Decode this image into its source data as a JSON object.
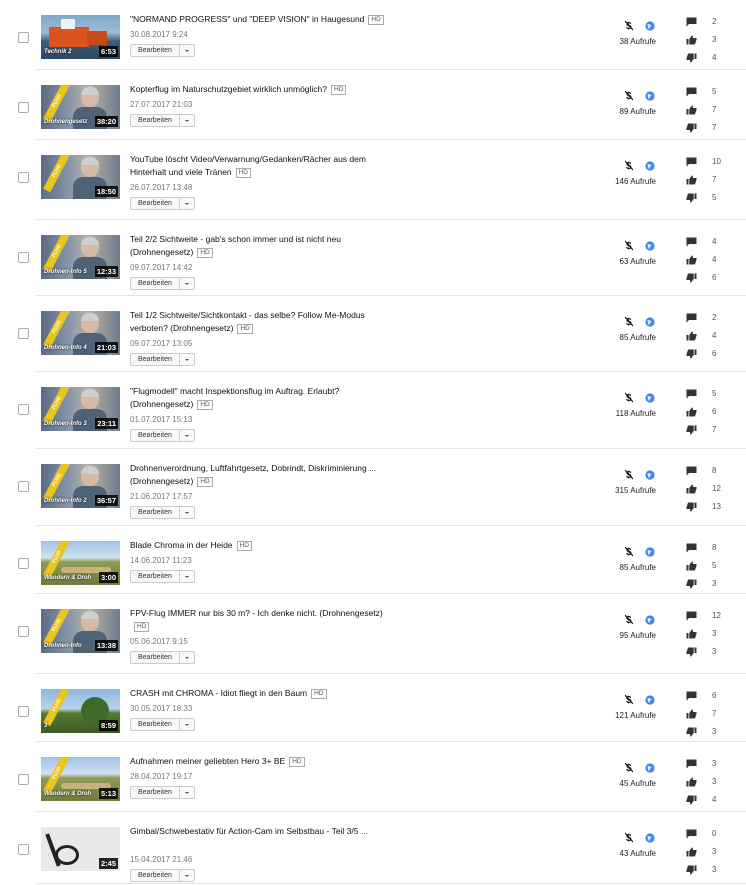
{
  "colors": {
    "globe": "#4285f4",
    "monetization": "#111111",
    "icon": "#333333",
    "hd_border": "#aaaaaa"
  },
  "icons": {
    "monetization": "dollar-slash-icon",
    "visibility": "globe-icon",
    "comments": "comment-icon",
    "likes": "thumbs-up-icon",
    "dislikes": "thumbs-down-icon"
  },
  "edit_label": "Bearbeiten",
  "hd_label": "HD",
  "videos": [
    {
      "title": "\"NORMAND PROGRESS\" und \"DEEP VISION\" in Haugesund",
      "hd": true,
      "date": "30.08.2017 9:24",
      "duration": "6:53",
      "thumb_text": "Technik 2",
      "flag_text": "",
      "views": "38 Aufrufe",
      "comments": "2",
      "likes": "3",
      "dislikes": "4",
      "scene": "ship"
    },
    {
      "title": "Kopterflug im Naturschutzgebiet wirklich unmöglich?",
      "hd": true,
      "date": "27.07.2017 21:03",
      "duration": "38:20",
      "thumb_text": "Drohnengesetz",
      "flag_text": "FLUG",
      "views": "89 Aufrufe",
      "comments": "5",
      "likes": "7",
      "dislikes": "7",
      "scene": "person"
    },
    {
      "title": "YouTube löscht Video/Verwarnung/Gedanken/Rächer aus dem Hinterhalt und viele Tränen",
      "hd": true,
      "date": "26.07.2017 13:48",
      "duration": "18:50",
      "thumb_text": "",
      "flag_text": "FLUG",
      "views": "146 Aufrufe",
      "comments": "10",
      "likes": "7",
      "dislikes": "5",
      "scene": "person"
    },
    {
      "title": "Teil 2/2 Sichtweite - gab's schon immer und ist nicht neu (Drohnengesetz)",
      "hd": true,
      "date": "09.07.2017 14:42",
      "duration": "12:33",
      "thumb_text": "Drohnen-Info 5",
      "flag_text": "FLUG",
      "views": "63 Aufrufe",
      "comments": "4",
      "likes": "4",
      "dislikes": "6",
      "scene": "person"
    },
    {
      "title": "Teil 1/2 Sichtweite/Sichtkontakt - das selbe? Follow Me-Modus verboten? (Drohnengesetz)",
      "hd": true,
      "date": "09.07.2017 13:05",
      "duration": "21:03",
      "thumb_text": "Drohnen-Info 4",
      "flag_text": "FLUG",
      "views": "85 Aufrufe",
      "comments": "2",
      "likes": "4",
      "dislikes": "6",
      "scene": "person"
    },
    {
      "title": "\"Flugmodell\" macht Inspektionsflug im Auftrag. Erlaubt? (Drohnengesetz)",
      "hd": true,
      "date": "01.07.2017 15:13",
      "duration": "23:11",
      "thumb_text": "Drohnen-Info 3",
      "flag_text": "FLUG",
      "views": "118 Aufrufe",
      "comments": "5",
      "likes": "6",
      "dislikes": "7",
      "scene": "person"
    },
    {
      "title": "Drohnenverordnung, Luftfahrtgesetz, Dobrindt, Diskriminierung ... (Drohnengesetz)",
      "hd": true,
      "date": "21.06.2017 17:57",
      "duration": "36:57",
      "thumb_text": "Drohnen-Info 2",
      "flag_text": "FLUG",
      "views": "315 Aufrufe",
      "comments": "8",
      "likes": "12",
      "dislikes": "13",
      "scene": "person"
    },
    {
      "title": "Blade Chroma in der Heide",
      "hd": true,
      "date": "14.06.2017 11:23",
      "duration": "3:00",
      "thumb_text": "Wandern & Droh",
      "flag_text": "FLUG",
      "views": "85 Aufrufe",
      "comments": "8",
      "likes": "5",
      "dislikes": "3",
      "scene": "landscape"
    },
    {
      "title": "FPV-Flug IMMER nur bis 30 m? - Ich denke nicht. (Drohnengesetz)",
      "hd": true,
      "date": "05.06.2017 9:15",
      "duration": "13:38",
      "thumb_text": "Drohnen-Info",
      "flag_text": "FLUG",
      "views": "95 Aufrufe",
      "comments": "12",
      "likes": "3",
      "dislikes": "3",
      "scene": "person"
    },
    {
      "title": "CRASH mit CHROMA - Idiot fliegt in den Baum",
      "hd": true,
      "date": "30.05.2017 18:33",
      "duration": "8:59",
      "thumb_text": "3",
      "flag_text": "FLUG",
      "views": "121 Aufrufe",
      "comments": "6",
      "likes": "7",
      "dislikes": "3",
      "scene": "tree"
    },
    {
      "title": "Aufnahmen meiner geliebten Hero 3+ BE",
      "hd": true,
      "date": "28.04.2017 19:17",
      "duration": "5:13",
      "thumb_text": "Wandern & Droh",
      "flag_text": "FLUG",
      "views": "45 Aufrufe",
      "comments": "3",
      "likes": "3",
      "dislikes": "4",
      "scene": "landscape"
    },
    {
      "title": "Gimbal/Schwebestativ für Action-Cam im Selbstbau - Teil 3/5   ...",
      "hd": false,
      "date": "15.04.2017 21:46",
      "duration": "2:45",
      "thumb_text": "",
      "flag_text": "",
      "views": "43 Aufrufe",
      "comments": "0",
      "likes": "3",
      "dislikes": "3",
      "scene": "gimbal"
    }
  ]
}
